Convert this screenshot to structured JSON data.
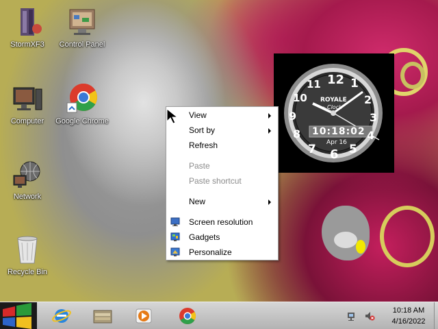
{
  "desktop": {
    "icons": [
      {
        "label": "StormXF3",
        "icon": "stormxf3-icon"
      },
      {
        "label": "Control Panel",
        "icon": "control-panel-icon"
      },
      {
        "label": "Computer",
        "icon": "computer-icon"
      },
      {
        "label": "Google Chrome",
        "icon": "chrome-icon"
      },
      {
        "label": "Network",
        "icon": "network-icon"
      },
      {
        "label": "Recycle Bin",
        "icon": "recycle-bin-icon"
      }
    ]
  },
  "gadget": {
    "brand": "ROYALE",
    "subtitle": "Clock",
    "digital_time": "10:18:02",
    "date": "Apr 16",
    "numerals": [
      "12",
      "1",
      "2",
      "3",
      "4",
      "5",
      "6",
      "7",
      "8",
      "9",
      "10",
      "11"
    ]
  },
  "context_menu": {
    "items": [
      {
        "label": "View",
        "disabled": false,
        "submenu": true
      },
      {
        "label": "Sort by",
        "disabled": false,
        "submenu": true
      },
      {
        "label": "Refresh",
        "disabled": false,
        "submenu": false
      },
      {
        "label": "Paste",
        "disabled": true,
        "submenu": false
      },
      {
        "label": "Paste shortcut",
        "disabled": true,
        "submenu": false
      },
      {
        "label": "New",
        "disabled": false,
        "submenu": true
      },
      {
        "label": "Screen resolution",
        "disabled": false,
        "icon": "screen-resolution-icon"
      },
      {
        "label": "Gadgets",
        "disabled": false,
        "icon": "gadgets-icon"
      },
      {
        "label": "Personalize",
        "disabled": false,
        "icon": "personalize-icon"
      }
    ]
  },
  "taskbar": {
    "pinned": [
      {
        "name": "internet-explorer",
        "icon": "internet-explorer-icon"
      },
      {
        "name": "file-explorer",
        "icon": "folder-icon"
      },
      {
        "name": "media-player",
        "icon": "media-player-icon"
      },
      {
        "name": "google-chrome",
        "icon": "chrome-icon"
      }
    ],
    "tray": {
      "time": "10:18 AM",
      "date": "4/16/2022"
    }
  },
  "colors": {
    "wallpaper_olive": "#b7ad55",
    "wallpaper_magenta": "#c41f5d",
    "menu_disabled": "#8c8c8c"
  }
}
